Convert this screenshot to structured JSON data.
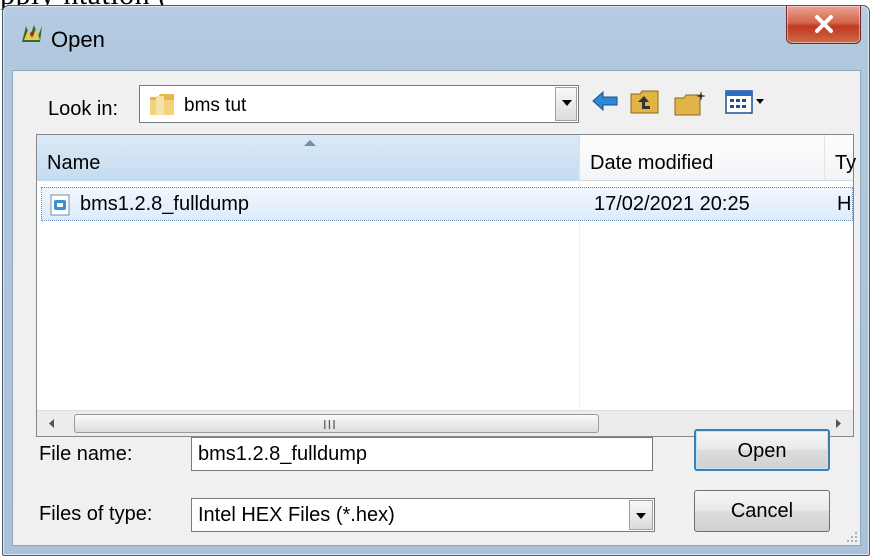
{
  "background_text": "pply        ntation             (        ",
  "window": {
    "title": "Open",
    "close_label": "x"
  },
  "lookin": {
    "label": "Look in:",
    "value": "bms tut"
  },
  "toolbar": {
    "icons": [
      "back-arrow-icon",
      "up-folder-icon",
      "new-folder-icon",
      "view-menu-icon"
    ]
  },
  "filelist": {
    "columns": [
      "Name",
      "Date modified",
      "Ty"
    ],
    "rows": [
      {
        "name": "bms1.2.8_fulldump",
        "date": "17/02/2021 20:25",
        "type": "H"
      }
    ],
    "scroll_grip": "III"
  },
  "filename": {
    "label": "File name:",
    "value": "bms1.2.8_fulldump"
  },
  "filetype": {
    "label": "Files of type:",
    "value": "Intel HEX Files (*.hex)"
  },
  "buttons": {
    "open": "Open",
    "cancel": "Cancel"
  },
  "colors": {
    "selection": "#dcebfc",
    "title_bar": "#b6cde3",
    "close": "#c0391f"
  }
}
